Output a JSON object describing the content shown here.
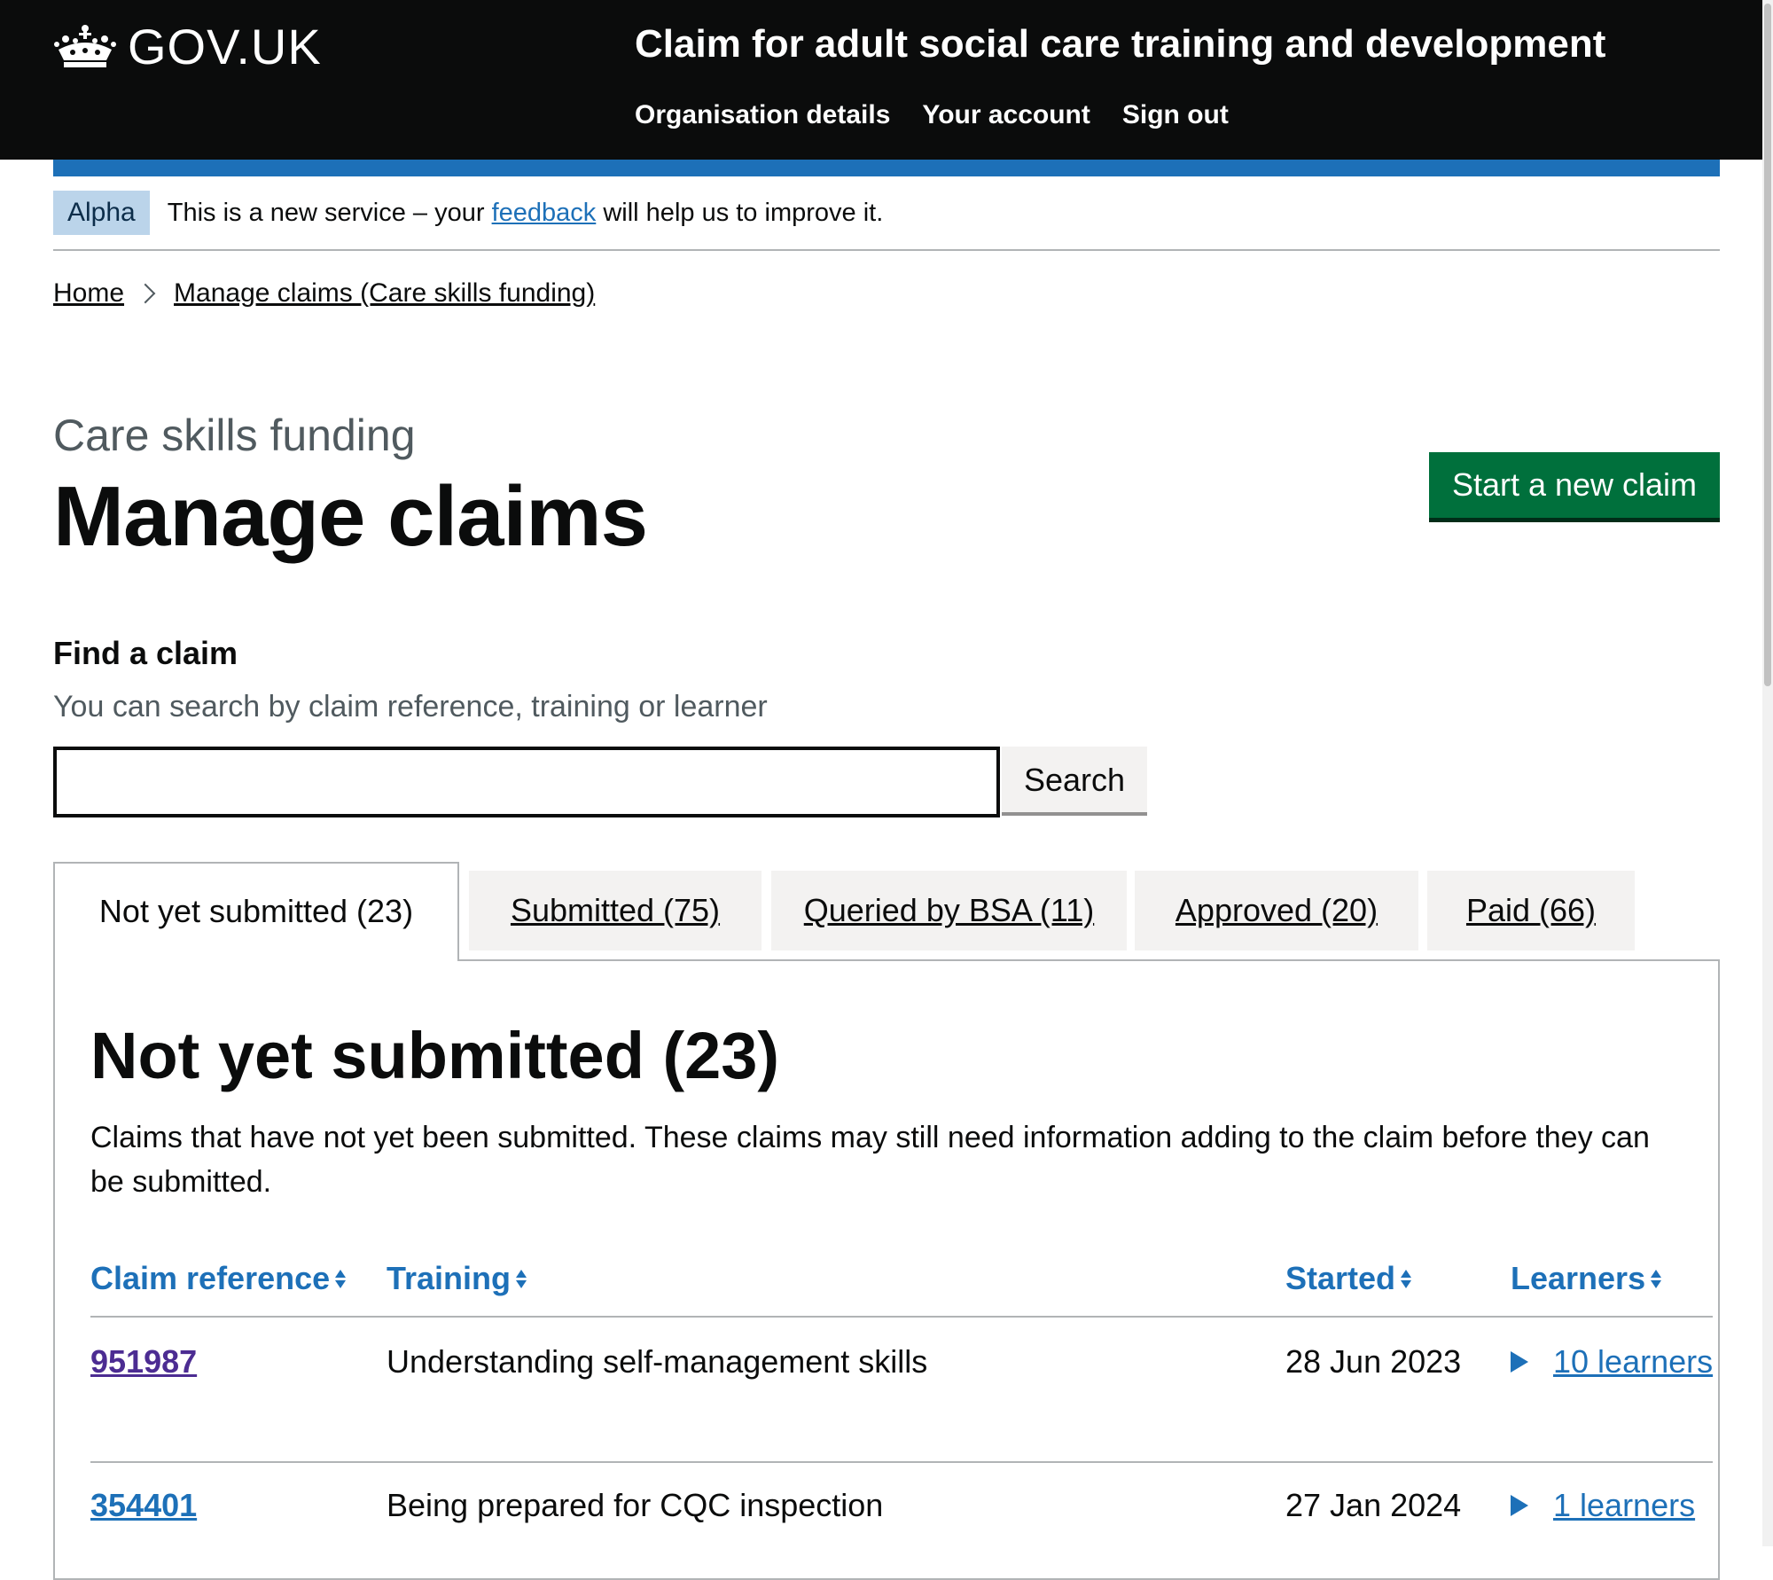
{
  "header": {
    "logo_text": "GOV.UK",
    "service_name": "Claim for adult social care training and development",
    "nav": [
      "Organisation details",
      "Your account",
      "Sign out"
    ]
  },
  "phase_banner": {
    "tag": "Alpha",
    "text_before": "This is a new service – your ",
    "link": "feedback",
    "text_after": " will help us to improve it."
  },
  "breadcrumb": [
    "Home",
    "Manage claims (Care skills funding)"
  ],
  "caption": "Care skills funding",
  "title": "Manage claims",
  "start_button": "Start a new claim",
  "search": {
    "label": "Find a claim",
    "hint": "You can search by claim reference, training or learner",
    "value": "",
    "button": "Search"
  },
  "tabs": [
    "Not yet submitted (23)",
    "Submitted (75)",
    "Queried by BSA (11)",
    "Approved (20)",
    "Paid (66)"
  ],
  "panel": {
    "heading": "Not yet submitted (23)",
    "description": "Claims that have not yet been submitted. These claims may still need information adding to the claim before they can be submitted."
  },
  "table": {
    "headers": [
      "Claim reference",
      "Training",
      "Started",
      "Learners"
    ],
    "rows": [
      {
        "ref": "951987",
        "training": "Understanding self-management skills",
        "started": "28 Jun 2023",
        "learners": "10 learners"
      },
      {
        "ref": "354401",
        "training": "Being prepared for CQC inspection",
        "started": "27 Jan 2024",
        "learners": "1 learners"
      }
    ]
  },
  "colors": {
    "header_bg": "#0b0c0c",
    "brand_blue": "#1d70b8",
    "start_green": "#00703c",
    "visited_link": "#4c2c92",
    "tag_bg": "#bbd4ea"
  }
}
